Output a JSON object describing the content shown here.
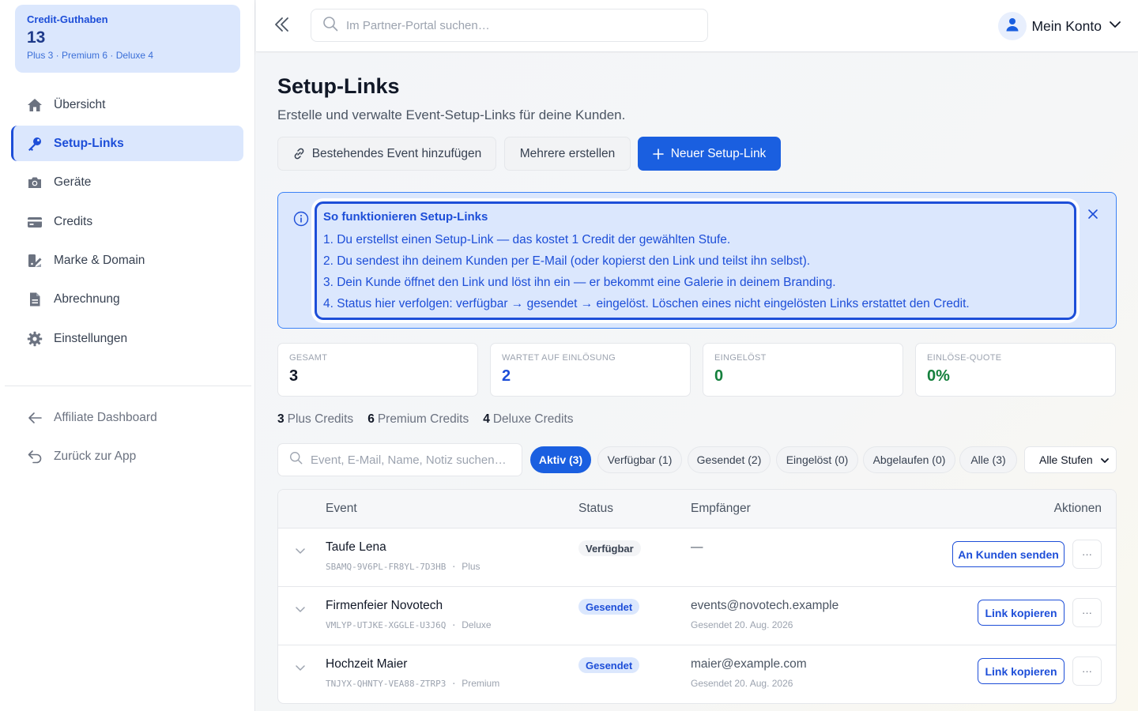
{
  "sidebar": {
    "credit_card": {
      "title": "Credit-Guthaben",
      "value": "13",
      "breakdown": "Plus 3 · Premium 6 · Deluxe 4"
    },
    "items": [
      {
        "label": "Übersicht",
        "icon": "home-icon"
      },
      {
        "label": "Setup-Links",
        "icon": "key-icon",
        "active": true
      },
      {
        "label": "Geräte",
        "icon": "camera-icon"
      },
      {
        "label": "Credits",
        "icon": "credit-card-icon"
      },
      {
        "label": "Marke & Domain",
        "icon": "brush-icon"
      },
      {
        "label": "Abrechnung",
        "icon": "document-icon"
      },
      {
        "label": "Einstellungen",
        "icon": "gear-icon"
      }
    ],
    "secondary": [
      {
        "label": "Affiliate Dashboard",
        "icon": "arrow-left-icon"
      },
      {
        "label": "Zurück zur App",
        "icon": "undo-icon"
      }
    ]
  },
  "header": {
    "search_placeholder": "Im Partner-Portal suchen…",
    "account_label": "Mein Konto"
  },
  "page": {
    "title": "Setup-Links",
    "subtitle": "Erstelle und verwalte Event-Setup-Links für deine Kunden.",
    "buttons": {
      "add_existing": "Bestehendes Event hinzufügen",
      "create_multiple": "Mehrere erstellen",
      "new_link": "Neuer Setup-Link"
    }
  },
  "info": {
    "title": "So funktionieren Setup-Links",
    "lines": [
      "1. Du erstellst einen Setup-Link — das kostet 1 Credit der gewählten Stufe.",
      "2. Du sendest ihn deinem Kunden per E-Mail (oder kopierst den Link und teilst ihn selbst).",
      "3. Dein Kunde öffnet den Link und löst ihn ein — er bekommt eine Galerie in deinem Branding.",
      "4. Status hier verfolgen: verfügbar → gesendet → eingelöst. Löschen eines nicht eingelösten Links erstattet den Credit."
    ]
  },
  "stats": [
    {
      "label": "GESAMT",
      "value": "3",
      "color": "#111827"
    },
    {
      "label": "WARTET AUF EINLÖSUNG",
      "value": "2",
      "color": "#1d4ed8"
    },
    {
      "label": "EINGELÖST",
      "value": "0",
      "color": "#15803d"
    },
    {
      "label": "EINLÖSE-QUOTE",
      "value": "0%",
      "color": "#15803d"
    }
  ],
  "credit_summary": [
    {
      "count": "3",
      "label": "Plus Credits"
    },
    {
      "count": "6",
      "label": "Premium Credits"
    },
    {
      "count": "4",
      "label": "Deluxe Credits"
    }
  ],
  "filters": {
    "search_placeholder": "Event, E-Mail, Name, Notiz suchen…",
    "chips": [
      {
        "label": "Aktiv (3)",
        "active": true
      },
      {
        "label": "Verfügbar (1)"
      },
      {
        "label": "Gesendet (2)"
      },
      {
        "label": "Eingelöst (0)"
      },
      {
        "label": "Abgelaufen (0)"
      },
      {
        "label": "Alle (3)"
      }
    ],
    "tier_select": "Alle Stufen"
  },
  "table": {
    "headers": {
      "event": "Event",
      "status": "Status",
      "recipient": "Empfänger",
      "actions": "Aktionen"
    },
    "rows": [
      {
        "name": "Taufe Lena",
        "code": "SBAMQ-9V6PL-FR8YL-7D3HB",
        "tier": "Plus",
        "status": "Verfügbar",
        "status_kind": "avail",
        "recipient": "—",
        "sent_date": "",
        "action": "An Kunden senden"
      },
      {
        "name": "Firmenfeier Novotech",
        "code": "VMLYP-UTJKE-XGGLE-U3J6Q",
        "tier": "Deluxe",
        "status": "Gesendet",
        "status_kind": "sent",
        "recipient": "events@novotech.example",
        "sent_date": "Gesendet 20. Aug. 2026",
        "action": "Link kopieren"
      },
      {
        "name": "Hochzeit Maier",
        "code": "TNJYX-QHNTY-VEA88-ZTRP3",
        "tier": "Premium",
        "status": "Gesendet",
        "status_kind": "sent",
        "recipient": "maier@example.com",
        "sent_date": "Gesendet 20. Aug. 2026",
        "action": "Link kopieren"
      }
    ],
    "more_label": "···"
  }
}
